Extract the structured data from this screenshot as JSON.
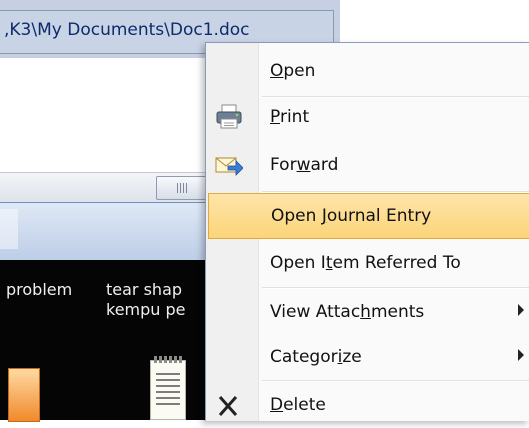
{
  "path": {
    "text": ",K3\\My Documents\\Doc1.doc"
  },
  "messages": {
    "col1": "problem",
    "col2_line1": "tear shap",
    "col2_line2": "kempu pe"
  },
  "menu": {
    "items": [
      {
        "label": "Open",
        "access_index": 0,
        "icon": "none",
        "highlighted": false
      },
      {
        "label": "Print",
        "access_index": 0,
        "icon": "printer-icon",
        "highlighted": false
      },
      {
        "label": "Forward",
        "access_index": 3,
        "icon": "forward-icon",
        "highlighted": false
      },
      {
        "label": "Open Journal Entry",
        "access_index": 5,
        "icon": "none",
        "highlighted": true
      },
      {
        "label": "Open Item Referred To",
        "access_index": 6,
        "icon": "none",
        "highlighted": false
      },
      {
        "label": "View Attachments",
        "access_index": 10,
        "icon": "none",
        "highlighted": false,
        "submenu": true
      },
      {
        "label": "Categorize",
        "access_index": 7,
        "icon": "none",
        "highlighted": false,
        "submenu": true
      },
      {
        "label": "Delete",
        "access_index": 0,
        "icon": "delete-x-icon",
        "highlighted": false
      }
    ]
  },
  "colors": {
    "highlight": "#fcd57a",
    "highlight_border": "#e3a83f",
    "path_bar": "#c9d3e6"
  }
}
